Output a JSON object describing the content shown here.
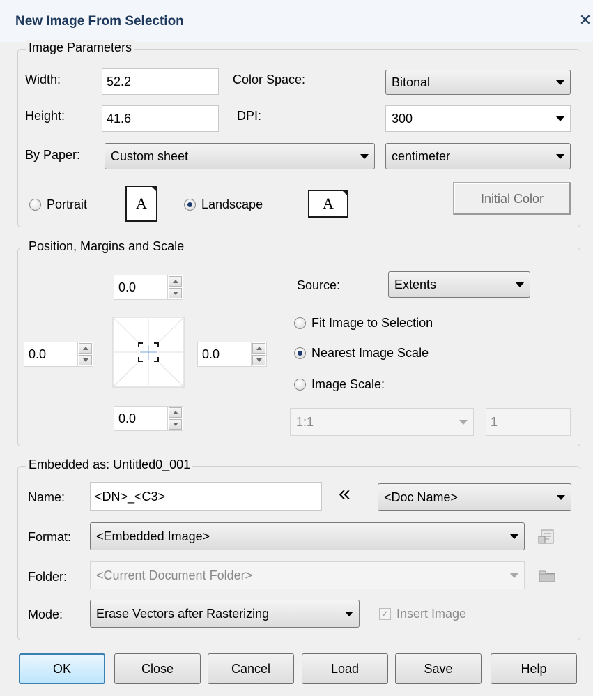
{
  "window": {
    "title": "New Image From Selection",
    "close_symbol": "✕"
  },
  "image_parameters": {
    "legend": "Image Parameters",
    "width_label": "Width:",
    "width_value": "52.2",
    "height_label": "Height:",
    "height_value": "41.6",
    "color_space_label": "Color Space:",
    "color_space_value": "Bitonal",
    "dpi_label": "DPI:",
    "dpi_value": "300",
    "paper_label": "By Paper:",
    "paper_value": "Custom sheet",
    "unit_value": "centimeter",
    "portrait_label": "Portrait",
    "portrait_selected": false,
    "landscape_label": "Landscape",
    "landscape_selected": true,
    "page_icon_letter": "A",
    "initial_color_label": "Initial Color"
  },
  "position": {
    "legend": "Position, Margins and Scale",
    "top_margin": "0.0",
    "left_margin": "0.0",
    "right_margin": "0.0",
    "bottom_margin": "0.0",
    "source_label": "Source:",
    "source_value": "Extents",
    "fit_label": "Fit Image to Selection",
    "fit_selected": false,
    "nearest_label": "Nearest Image Scale",
    "nearest_selected": true,
    "scale_label": "Image Scale:",
    "scale_selected": false,
    "scale_value": "1:1",
    "scale_number": "1"
  },
  "embedded": {
    "legend": "Embedded as: Untitled0_001",
    "name_label": "Name:",
    "name_value": "<DN>_<C3>",
    "insert_symbol": "«",
    "doc_name_value": "<Doc Name>",
    "format_label": "Format:",
    "format_value": "<Embedded Image>",
    "folder_label": "Folder:",
    "folder_placeholder": "<Current Document Folder>",
    "mode_label": "Mode:",
    "mode_value": "Erase Vectors after Rasterizing",
    "insert_image_label": "Insert Image",
    "insert_image_checked": true,
    "check_symbol": "✓"
  },
  "buttons": {
    "ok": "OK",
    "close": "Close",
    "cancel": "Cancel",
    "load": "Load",
    "save": "Save",
    "help": "Help"
  },
  "colors": {
    "title": "#1e395b",
    "default_button": "#3c7fb1",
    "radio_dot": "#1c3a6b"
  },
  "icons": [
    "close-icon",
    "portrait-page-icon",
    "landscape-page-icon",
    "margins-diagram-icon",
    "format-settings-icon",
    "folder-icon",
    "chevron-double-left-icon"
  ]
}
